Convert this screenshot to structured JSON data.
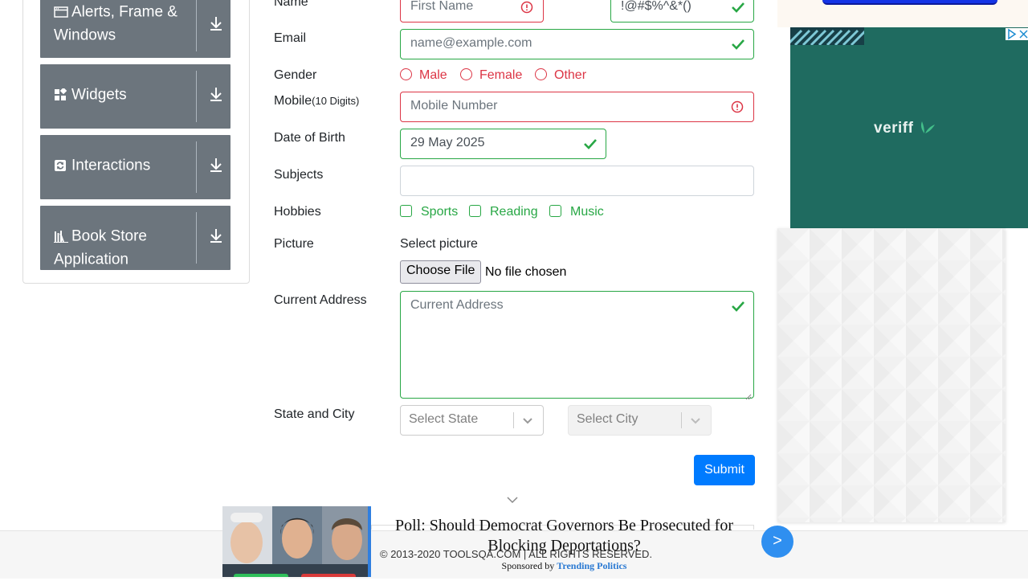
{
  "sidebar": {
    "groups": [
      {
        "label": "Alerts, Frame & Windows",
        "icon": "window-icon"
      },
      {
        "label": "Widgets",
        "icon": "widgets-icon"
      },
      {
        "label": "Interactions",
        "icon": "interactions-icon"
      },
      {
        "label": "Book Store Application",
        "icon": "book-store-icon"
      }
    ],
    "expand_icon": "download-arrow-icon"
  },
  "form": {
    "name_label": "Name",
    "first_name_placeholder": "First Name",
    "last_name_value": "!@#$%^&*()",
    "email_label": "Email",
    "email_placeholder": "name@example.com",
    "gender_label": "Gender",
    "gender_options": [
      "Male",
      "Female",
      "Other"
    ],
    "mobile_label": "Mobile",
    "mobile_hint": "(10 Digits)",
    "mobile_placeholder": "Mobile Number",
    "dob_label": "Date of Birth",
    "dob_value": "29 May 2025",
    "subjects_label": "Subjects",
    "hobbies_label": "Hobbies",
    "hobby_options": [
      "Sports",
      "Reading",
      "Music"
    ],
    "picture_label": "Picture",
    "picture_caption": "Select picture",
    "choose_file_label": "Choose File",
    "no_file_text": "No file chosen",
    "address_label": "Current Address",
    "address_placeholder": "Current Address",
    "state_city_label": "State and City",
    "state_placeholder": "Select State",
    "city_placeholder": "Select City",
    "submit_label": "Submit"
  },
  "ads": {
    "veriff_logo": "veriff",
    "adchoice_icons": [
      "adchoices-icon",
      "close-icon"
    ],
    "bottom_headline": "Poll: Should Democrat Governors Be Prosecuted for Blocking Deportations?",
    "sponsored_by": "Sponsored by",
    "sponsor_name": "Trending Politics",
    "next_button": ">"
  },
  "footer": {
    "copyright": "© 2013-2020 TOOLSQA.COM | ALL RIGHTS RESERVED."
  },
  "colors": {
    "valid": "#28a745",
    "invalid": "#dc3545",
    "primary": "#007bff",
    "sidebar_group": "#6c757d",
    "veriff_bg": "#1f6b60"
  }
}
